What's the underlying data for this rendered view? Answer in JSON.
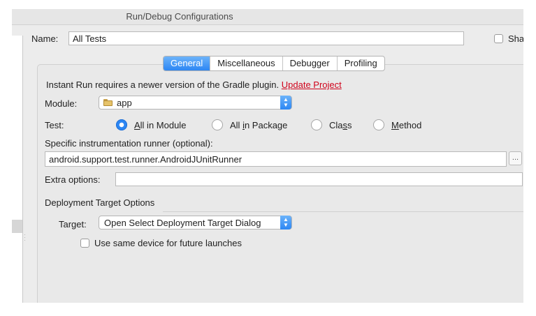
{
  "window": {
    "title": "Run/Debug Configurations"
  },
  "name_field": {
    "label": "Name:",
    "value": "All Tests"
  },
  "share_checkbox": {
    "label": "Sha",
    "checked": false
  },
  "tabs": [
    {
      "label": "General",
      "active": true
    },
    {
      "label": "Miscellaneous",
      "active": false
    },
    {
      "label": "Debugger",
      "active": false
    },
    {
      "label": "Profiling",
      "active": false
    }
  ],
  "instant_run": {
    "message": "Instant Run requires a newer version of the Gradle plugin.",
    "link": "Update Project"
  },
  "module": {
    "label": "Module:",
    "value": "app",
    "icon": "folder-icon"
  },
  "test": {
    "label": "Test:",
    "options": [
      {
        "pre": "",
        "mnemonic": "A",
        "post": "ll in Module",
        "selected": true
      },
      {
        "pre": "All ",
        "mnemonic": "i",
        "post": "n Package",
        "selected": false
      },
      {
        "pre": "Cla",
        "mnemonic": "s",
        "post": "s",
        "selected": false
      },
      {
        "pre": "",
        "mnemonic": "M",
        "post": "ethod",
        "selected": false
      }
    ]
  },
  "runner": {
    "label": "Specific instrumentation runner (optional):",
    "value": "android.support.test.runner.AndroidJUnitRunner",
    "browse_label": "..."
  },
  "extra_options": {
    "label": "Extra options:",
    "value": ""
  },
  "deployment": {
    "section_title": "Deployment Target Options",
    "target_label": "Target:",
    "target_value": "Open Select Deployment Target Dialog",
    "same_device_label": "Use same device for future launches",
    "same_device_checked": false
  },
  "colors": {
    "accent": "#2c86f3",
    "link": "#d0021b",
    "background": "#ececec"
  }
}
